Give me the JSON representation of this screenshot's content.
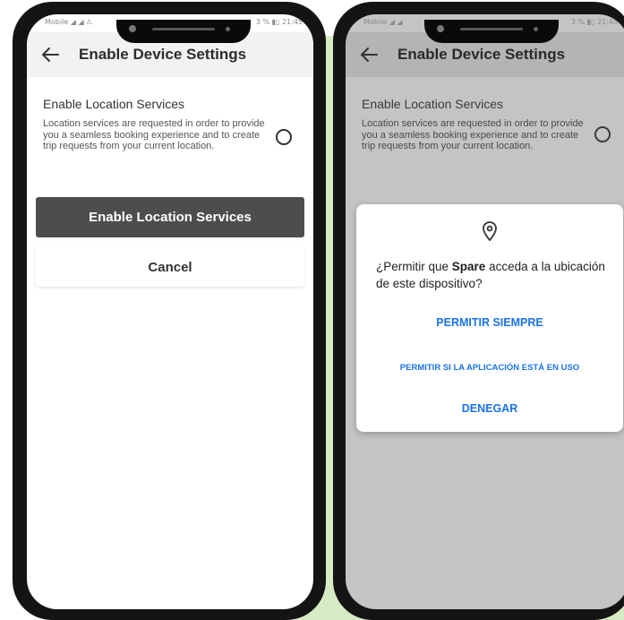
{
  "colors": {
    "background_panel": "#d6ebc4",
    "primary_button": "#4d4d4d",
    "dialog_action": "#1a73e8"
  },
  "left_phone": {
    "status_left": "Mobile ◢ ◢ ⚠",
    "status_right": "3 % ▮▯ 21:45",
    "header": {
      "back_icon": "arrow-left-icon",
      "title": "Enable Device Settings"
    },
    "location": {
      "title": "Enable Location Services",
      "description": "Location services are requested in order to provide you a seamless booking experience and to create trip requests from your current location.",
      "toggle_state": "off"
    },
    "primary_button": "Enable Location Services",
    "cancel_button": "Cancel"
  },
  "right_phone": {
    "status_left": "Mobile ◢ ◢",
    "status_right": "3 % ▮▯ 21:45",
    "header": {
      "back_icon": "arrow-left-icon",
      "title": "Enable Device Settings"
    },
    "location": {
      "title": "Enable Location Services",
      "description": "Location services are requested in order to provide you a seamless booking experience and to create trip requests from your current location.",
      "toggle_state": "off"
    },
    "dialog": {
      "icon": "location-pin-icon",
      "message_pre": "¿Permitir que ",
      "app_name": "Spare",
      "message_post": " acceda a la ubicación de este dispositivo?",
      "allow_always": "PERMITIR SIEMPRE",
      "allow_in_use": "PERMITIR SI LA APLICACIÓN ESTÁ EN USO",
      "deny": "DENEGAR"
    }
  }
}
